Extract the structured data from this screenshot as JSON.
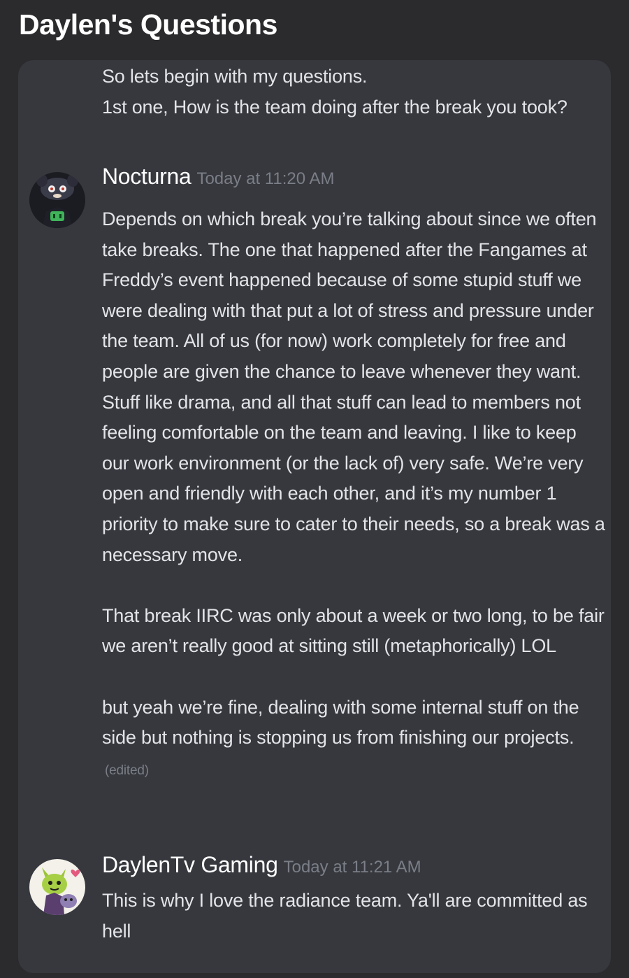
{
  "header": {
    "title": "Daylen's Questions"
  },
  "continuation_message": {
    "lines": [
      "So lets begin with my questions.",
      "1st one, How is the team doing after the break you took?"
    ]
  },
  "messages": [
    {
      "username": "Nocturna",
      "timestamp": "Today at 11:20 AM",
      "avatar_icon": "dark-character-avatar",
      "paragraphs": [
        "Depends on which break you’re talking about since we often take breaks. The one that happened after the Fangames at Freddy’s event happened because of some stupid stuff we were dealing with that put a lot of stress and pressure under the team. All of us (for now) work completely for free and people are given the chance to leave whenever they want. Stuff like drama, and all that stuff can lead to members not feeling comfortable on the team and leaving. I like to keep our work environment (or the lack of) very safe. We’re very open and friendly with each other, and it’s my number 1 priority to make sure to cater to their needs, so a break was a necessary move.",
        "That break IIRC was only about a week or two long, to be fair we aren’t really good at sitting still (metaphorically) LOL",
        "but yeah we’re fine, dealing with some internal stuff on the side but nothing is stopping us from finishing our projects."
      ],
      "edited_label": "(edited)"
    },
    {
      "username": "DaylenTv Gaming",
      "timestamp": "Today at 11:21 AM",
      "avatar_icon": "green-character-avatar",
      "paragraphs": [
        "This is why I love the radiance team. Ya'll are committed as hell"
      ]
    }
  ],
  "colors": {
    "page_background": "#2b2a2c",
    "panel_background": "#36383e",
    "text": "#e3e4e7",
    "timestamp": "#7b7e86",
    "username": "#ffffff"
  }
}
